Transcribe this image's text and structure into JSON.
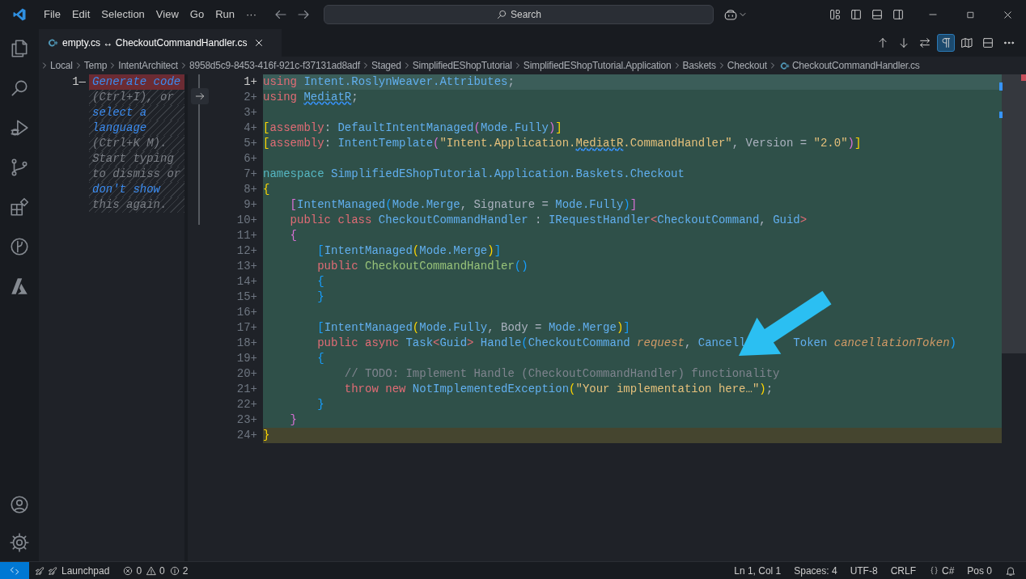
{
  "title_bar": {
    "menu": [
      "File",
      "Edit",
      "Selection",
      "View",
      "Go",
      "Run",
      "···"
    ],
    "search": {
      "label": "Search"
    }
  },
  "activity_bar": {
    "top": [
      {
        "kind": "files"
      },
      {
        "kind": "search"
      },
      {
        "kind": "debug"
      },
      {
        "kind": "scm"
      },
      {
        "kind": "extensions"
      },
      {
        "kind": "gitgraph"
      },
      {
        "kind": "azure"
      }
    ],
    "bottom": [
      {
        "kind": "account"
      },
      {
        "kind": "settings"
      }
    ]
  },
  "tabs": [
    {
      "label": "empty.cs ↔ CheckoutCommandHandler.cs",
      "selected": true
    }
  ],
  "editor_actions": [
    {
      "kind": "up",
      "on": false
    },
    {
      "kind": "down",
      "on": false
    },
    {
      "kind": "swap",
      "on": false
    },
    {
      "kind": "whitespace",
      "on": true
    },
    {
      "kind": "map",
      "on": false
    },
    {
      "kind": "split",
      "on": false
    },
    {
      "kind": "more",
      "on": false
    }
  ],
  "breadcrumbs": [
    {
      "label": "Local",
      "kind": "folder"
    },
    {
      "label": "Temp",
      "kind": "folder"
    },
    {
      "label": "IntentArchitect",
      "kind": "folder"
    },
    {
      "label": "8958d5c9-8453-416f-921c-f37131ad8adf",
      "kind": "folder"
    },
    {
      "label": "Staged",
      "kind": "folder"
    },
    {
      "label": "SimplifiedEShopTutorial",
      "kind": "folder"
    },
    {
      "label": "SimplifiedEShopTutorial.Application",
      "kind": "folder"
    },
    {
      "label": "Baskets",
      "kind": "folder"
    },
    {
      "label": "Checkout",
      "kind": "folder"
    },
    {
      "label": "CheckoutCommandHandler.cs",
      "kind": "file"
    }
  ],
  "diff": {
    "original": {
      "lines": [
        {
          "number": "1",
          "marker": "—"
        }
      ],
      "hint": [
        {
          "text": "Generate code",
          "kind": "link"
        },
        {
          "text": "(Ctrl+I), or",
          "kind": "text"
        },
        {
          "text": "select a",
          "kind": "link"
        },
        {
          "text": "language",
          "kind": "link"
        },
        {
          "text": "(Ctrl+K M).",
          "kind": "text"
        },
        {
          "text": "Start typing",
          "kind": "text"
        },
        {
          "text": "to dismiss or",
          "kind": "text"
        },
        {
          "text": "don't show",
          "kind": "link"
        },
        {
          "text": "this again.",
          "kind": "text"
        }
      ]
    },
    "modified": {
      "lines": [
        {
          "number": "1",
          "marker": "+",
          "kind": "cursor",
          "tokens": [
            {
              "text": "using",
              "kind": "k"
            },
            {
              "text": " Intent.RoslynWeaver.Attributes",
              "kind": "n"
            },
            {
              "text": ";",
              "kind": "p"
            }
          ]
        },
        {
          "number": "2",
          "marker": "+",
          "kind": "added",
          "tokens": [
            {
              "text": "using ",
              "kind": "k"
            },
            {
              "text": "MediatR",
              "kind": "nw"
            },
            {
              "text": ";",
              "kind": "p"
            }
          ]
        },
        {
          "number": "3",
          "marker": "+",
          "kind": "added"
        },
        {
          "number": "4",
          "marker": "+",
          "kind": "added",
          "tokens": [
            {
              "text": "[",
              "kind": "b0"
            },
            {
              "text": "assembly",
              "kind": "k"
            },
            {
              "text": ": ",
              "kind": "p"
            },
            {
              "text": "DefaultIntentManaged",
              "kind": "n"
            },
            {
              "text": "(",
              "kind": "b1"
            },
            {
              "text": "Mode.Fully",
              "kind": "n"
            },
            {
              "text": ")",
              "kind": "b1"
            },
            {
              "text": "]",
              "kind": "b0"
            }
          ]
        },
        {
          "number": "5",
          "marker": "+",
          "kind": "added",
          "tokens": [
            {
              "text": "[",
              "kind": "b0"
            },
            {
              "text": "assembly",
              "kind": "k"
            },
            {
              "text": ": ",
              "kind": "p"
            },
            {
              "text": "IntentTemplate",
              "kind": "n"
            },
            {
              "text": "(",
              "kind": "b1"
            },
            {
              "text": "\"Intent.Application.",
              "kind": "s"
            },
            {
              "text": "MediatR",
              "kind": "sw"
            },
            {
              "text": ".CommandHandler\"",
              "kind": "s"
            },
            {
              "text": ", Version = ",
              "kind": "p"
            },
            {
              "text": "\"2.0\"",
              "kind": "s"
            },
            {
              "text": ")",
              "kind": "b1"
            },
            {
              "text": "]",
              "kind": "b0"
            }
          ]
        },
        {
          "number": "6",
          "marker": "+",
          "kind": "added"
        },
        {
          "number": "7",
          "marker": "+",
          "kind": "added",
          "tokens": [
            {
              "text": "namespace",
              "kind": "t"
            },
            {
              "text": " SimplifiedEShopTutorial.Application.Baskets.Checkout",
              "kind": "n"
            }
          ]
        },
        {
          "number": "8",
          "marker": "+",
          "kind": "added",
          "tokens": [
            {
              "text": "{",
              "kind": "b0"
            }
          ]
        },
        {
          "number": "9",
          "marker": "+",
          "kind": "added",
          "tokens": [
            {
              "text": "    [",
              "kind": "b1"
            },
            {
              "text": "IntentManaged",
              "kind": "n"
            },
            {
              "text": "(",
              "kind": "b2"
            },
            {
              "text": "Mode.Merge",
              "kind": "n"
            },
            {
              "text": ", Signature = ",
              "kind": "p"
            },
            {
              "text": "Mode.Fully",
              "kind": "n"
            },
            {
              "text": ")",
              "kind": "b2"
            },
            {
              "text": "]",
              "kind": "b1"
            }
          ]
        },
        {
          "number": "10",
          "marker": "+",
          "kind": "added",
          "tokens": [
            {
              "text": "    public class",
              "kind": "k"
            },
            {
              "text": " CheckoutCommandHandler",
              "kind": "n"
            },
            {
              "text": " : ",
              "kind": "p"
            },
            {
              "text": "IRequestHandler",
              "kind": "n"
            },
            {
              "text": "<",
              "kind": "k"
            },
            {
              "text": "CheckoutCommand",
              "kind": "n"
            },
            {
              "text": ", ",
              "kind": "p"
            },
            {
              "text": "Guid",
              "kind": "n"
            },
            {
              "text": ">",
              "kind": "k"
            }
          ]
        },
        {
          "number": "11",
          "marker": "+",
          "kind": "added",
          "tokens": [
            {
              "text": "    {",
              "kind": "b1"
            }
          ]
        },
        {
          "number": "12",
          "marker": "+",
          "kind": "added",
          "tokens": [
            {
              "text": "        [",
              "kind": "b2"
            },
            {
              "text": "IntentManaged",
              "kind": "n"
            },
            {
              "text": "(",
              "kind": "b0"
            },
            {
              "text": "Mode.Merge",
              "kind": "n"
            },
            {
              "text": ")",
              "kind": "b0"
            },
            {
              "text": "]",
              "kind": "b2"
            }
          ]
        },
        {
          "number": "13",
          "marker": "+",
          "kind": "added",
          "tokens": [
            {
              "text": "        public",
              "kind": "k"
            },
            {
              "text": " CheckoutCommandHandler",
              "kind": "f"
            },
            {
              "text": "()",
              "kind": "b2"
            }
          ]
        },
        {
          "number": "14",
          "marker": "+",
          "kind": "added",
          "tokens": [
            {
              "text": "        {",
              "kind": "b2"
            }
          ]
        },
        {
          "number": "15",
          "marker": "+",
          "kind": "added",
          "tokens": [
            {
              "text": "        }",
              "kind": "b2"
            }
          ]
        },
        {
          "number": "16",
          "marker": "+",
          "kind": "added"
        },
        {
          "number": "17",
          "marker": "+",
          "kind": "added",
          "tokens": [
            {
              "text": "        [",
              "kind": "b2"
            },
            {
              "text": "IntentManaged",
              "kind": "n"
            },
            {
              "text": "(",
              "kind": "b0"
            },
            {
              "text": "Mode.Fully",
              "kind": "n"
            },
            {
              "text": ", Body = ",
              "kind": "p"
            },
            {
              "text": "Mode.Merge",
              "kind": "n"
            },
            {
              "text": ")",
              "kind": "b0"
            },
            {
              "text": "]",
              "kind": "b2"
            }
          ]
        },
        {
          "number": "18",
          "marker": "+",
          "kind": "added",
          "tokens": [
            {
              "text": "        public async",
              "kind": "k"
            },
            {
              "text": " Task",
              "kind": "n"
            },
            {
              "text": "<",
              "kind": "k"
            },
            {
              "text": "Guid",
              "kind": "n"
            },
            {
              "text": ">",
              "kind": "k"
            },
            {
              "text": " Handle",
              "kind": "n"
            },
            {
              "text": "(",
              "kind": "b2"
            },
            {
              "text": "CheckoutCommand",
              "kind": "n"
            },
            {
              "text": " request",
              "kind": "a"
            },
            {
              "text": ", ",
              "kind": "p"
            },
            {
              "text": "Cancell",
              "kind": "n"
            },
            {
              "kind": "covered"
            },
            {
              "text": "Token",
              "kind": "n"
            },
            {
              "text": " cancellationToken",
              "kind": "a"
            },
            {
              "text": ")",
              "kind": "b2"
            }
          ]
        },
        {
          "number": "19",
          "marker": "+",
          "kind": "added",
          "tokens": [
            {
              "text": "        {",
              "kind": "b2"
            }
          ]
        },
        {
          "number": "20",
          "marker": "+",
          "kind": "added",
          "tokens": [
            {
              "text": "            // TODO: Implement Handle (CheckoutCommandHandler) functionality",
              "kind": "c"
            }
          ]
        },
        {
          "number": "21",
          "marker": "+",
          "kind": "added",
          "tokens": [
            {
              "text": "            throw new",
              "kind": "k"
            },
            {
              "text": " NotImplementedException",
              "kind": "n"
            },
            {
              "text": "(",
              "kind": "b0"
            },
            {
              "text": "\"Your implementation here…\"",
              "kind": "s"
            },
            {
              "text": ")",
              "kind": "b0"
            },
            {
              "text": ";",
              "kind": "p"
            }
          ]
        },
        {
          "number": "22",
          "marker": "+",
          "kind": "added",
          "tokens": [
            {
              "text": "        }",
              "kind": "b2"
            }
          ]
        },
        {
          "number": "23",
          "marker": "+",
          "kind": "added",
          "tokens": [
            {
              "text": "    }",
              "kind": "b1"
            }
          ]
        },
        {
          "number": "24",
          "marker": "+",
          "kind": "marked",
          "tokens": [
            {
              "text": "}",
              "kind": "b0"
            }
          ]
        }
      ]
    }
  },
  "status_bar": {
    "left": [
      {
        "kind": "remote"
      },
      {
        "kind": "launchpad",
        "label": "Launchpad"
      },
      {
        "kind": "problems",
        "errors": "0",
        "warnings": "0",
        "infos": "2"
      }
    ],
    "right": [
      {
        "kind": "text",
        "label": "Ln 1, Col 1"
      },
      {
        "kind": "text",
        "label": "Spaces: 4"
      },
      {
        "kind": "text",
        "label": "UTF-8"
      },
      {
        "kind": "text",
        "label": "CRLF"
      },
      {
        "kind": "language",
        "label": "C#"
      },
      {
        "kind": "text",
        "label": "Pos 0"
      },
      {
        "kind": "bell"
      }
    ]
  }
}
